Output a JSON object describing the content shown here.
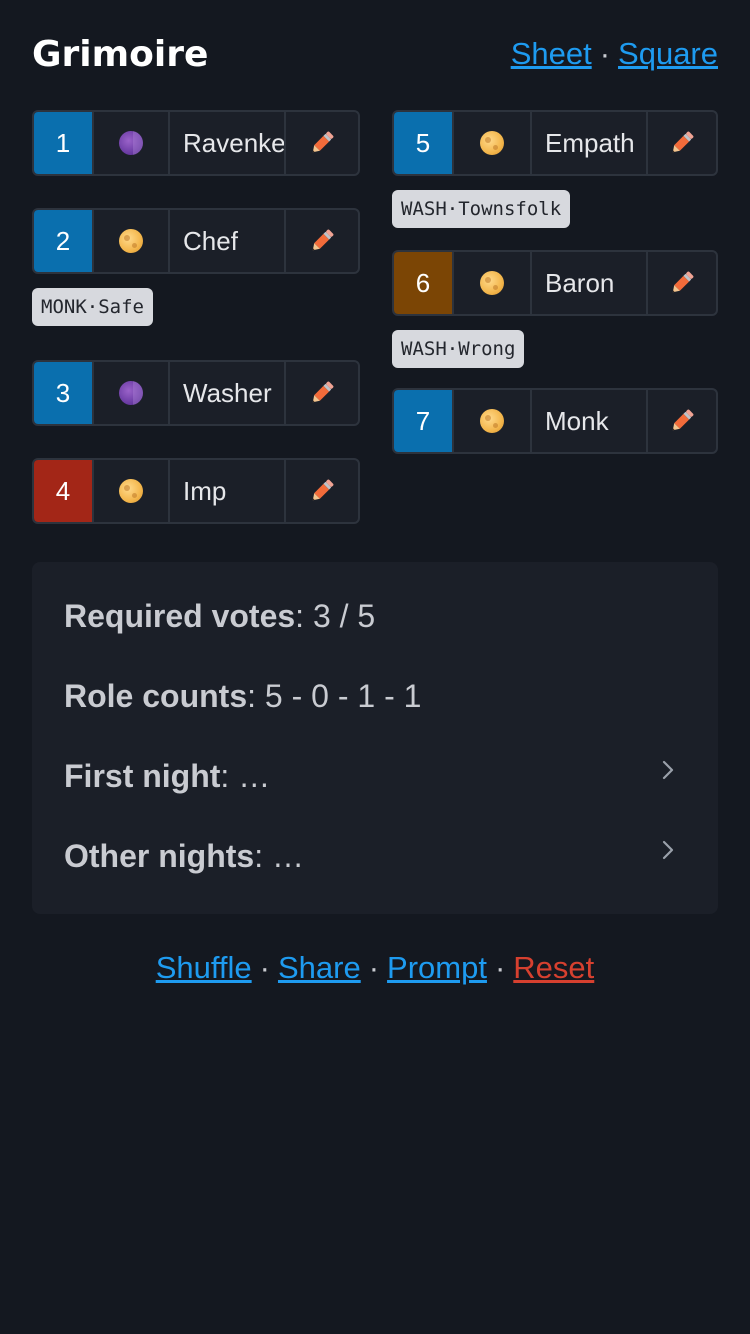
{
  "header": {
    "title": "Grimoire",
    "links": {
      "sheet": "Sheet",
      "square": "Square",
      "separator": "·"
    }
  },
  "colors": {
    "townsfolk": "#0a6fae",
    "demon": "#a32617",
    "minion": "#7b4505",
    "link": "#1e9bf0",
    "reset": "#d6402f",
    "background": "#141820"
  },
  "players": [
    {
      "number": "1",
      "name": "Ravenkeeper",
      "moon": "new-moon-icon",
      "alignment_color": "#0a6fae"
    },
    {
      "number": "2",
      "name": "Chef",
      "moon": "full-moon-icon",
      "alignment_color": "#0a6fae",
      "reminder": "MONK·Safe"
    },
    {
      "number": "3",
      "name": "Washer",
      "moon": "new-moon-icon",
      "alignment_color": "#0a6fae"
    },
    {
      "number": "4",
      "name": "Imp",
      "moon": "full-moon-icon",
      "alignment_color": "#a32617"
    },
    {
      "number": "5",
      "name": "Empath",
      "moon": "full-moon-icon",
      "alignment_color": "#0a6fae",
      "reminder": "WASH·Townsfolk"
    },
    {
      "number": "6",
      "name": "Baron",
      "moon": "full-moon-icon",
      "alignment_color": "#7b4505",
      "reminder": "WASH·Wrong"
    },
    {
      "number": "7",
      "name": "Monk",
      "moon": "full-moon-icon",
      "alignment_color": "#0a6fae"
    }
  ],
  "info": {
    "required_votes": {
      "label": "Required votes",
      "value": ": 3 / 5"
    },
    "role_counts": {
      "label": "Role counts",
      "value": ": 5 - 0 - 1 - 1"
    },
    "first_night": {
      "label": "First night",
      "value": ": …"
    },
    "other_nights": {
      "label": "Other nights",
      "value": ": …"
    }
  },
  "footer": {
    "shuffle": "Shuffle",
    "share": "Share",
    "prompt": "Prompt",
    "reset": "Reset",
    "separator": "·"
  }
}
